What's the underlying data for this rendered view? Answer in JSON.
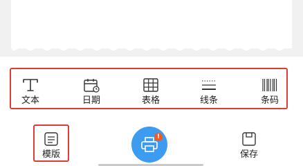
{
  "toolbar": {
    "items": [
      {
        "label": "文本",
        "icon": "text-icon"
      },
      {
        "label": "日期",
        "icon": "calendar-icon"
      },
      {
        "label": "表格",
        "icon": "table-icon"
      },
      {
        "label": "线条",
        "icon": "line-icon"
      },
      {
        "label": "条码",
        "icon": "barcode-icon"
      }
    ]
  },
  "bottom_bar": {
    "template_label": "模版",
    "save_label": "保存",
    "print_badge": "!"
  },
  "colors": {
    "highlight": "#e53935",
    "accent": "#3d9cf0",
    "badge": "#ef5a28"
  }
}
